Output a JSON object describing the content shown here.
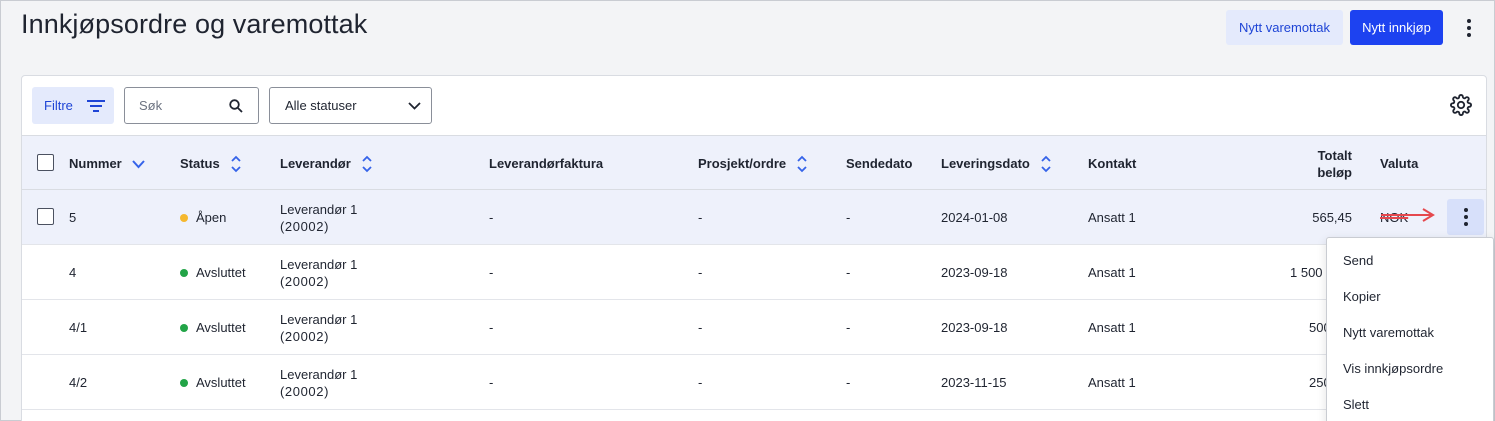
{
  "header": {
    "title": "Innkjøpsordre og varemottak",
    "new_goods_receipt": "Nytt varemottak",
    "new_purchase": "Nytt innkjøp"
  },
  "toolbar": {
    "filter_label": "Filtre",
    "search_placeholder": "Søk",
    "status_select": "Alle statuser"
  },
  "columns": {
    "number": "Nummer",
    "status": "Status",
    "supplier": "Leverandør",
    "supplier_invoice": "Leverandørfaktura",
    "project": "Prosjekt/ordre",
    "send_date": "Sendedato",
    "delivery_date": "Leveringsdato",
    "contact": "Kontakt",
    "total_line1": "Totalt",
    "total_line2": "beløp",
    "currency": "Valuta"
  },
  "rows": [
    {
      "number": "5",
      "status": "Åpen",
      "supplier": "Leverandør 1",
      "supplier_code": "(20002)",
      "invoice": "-",
      "project": "-",
      "send_date": "-",
      "delivery_date": "2024-01-08",
      "contact": "Ansatt 1",
      "total": "565,45",
      "currency": "NOK"
    },
    {
      "number": "4",
      "status": "Avsluttet",
      "supplier": "Leverandør 1",
      "supplier_code": "(20002)",
      "invoice": "-",
      "project": "-",
      "send_date": "-",
      "delivery_date": "2023-09-18",
      "contact": "Ansatt 1",
      "total": "1 500",
      "currency": ""
    },
    {
      "number": "4/1",
      "status": "Avsluttet",
      "supplier": "Leverandør 1",
      "supplier_code": "(20002)",
      "invoice": "-",
      "project": "-",
      "send_date": "-",
      "delivery_date": "2023-09-18",
      "contact": "Ansatt 1",
      "total": "500",
      "currency": ""
    },
    {
      "number": "4/2",
      "status": "Avsluttet",
      "supplier": "Leverandør 1",
      "supplier_code": "(20002)",
      "invoice": "-",
      "project": "-",
      "send_date": "-",
      "delivery_date": "2023-11-15",
      "contact": "Ansatt 1",
      "total": "250",
      "currency": ""
    }
  ],
  "status_colors": {
    "open": "#f5b82e",
    "closed": "#22a447"
  },
  "context_menu": {
    "items": [
      "Send",
      "Kopier",
      "Nytt varemottak",
      "Vis innkjøpsordre",
      "Slett"
    ]
  },
  "colors": {
    "primary": "#1d42f0",
    "secondary_bg": "#e4eafc",
    "annotation_arrow": "#e5484d"
  }
}
